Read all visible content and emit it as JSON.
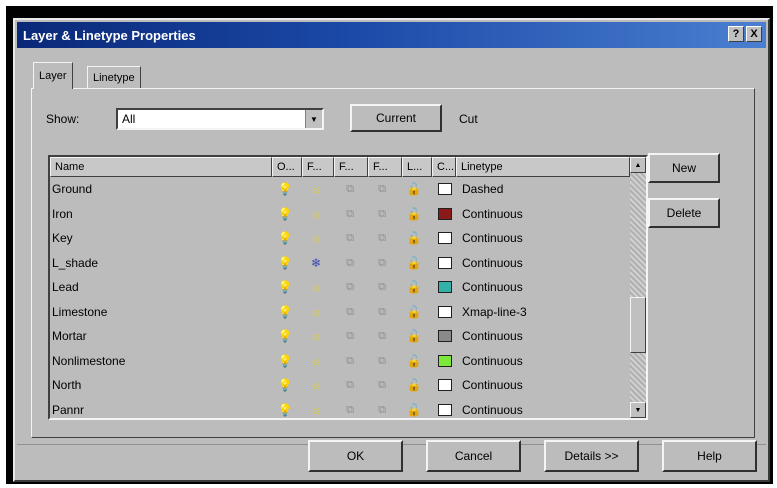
{
  "window": {
    "title": "Layer & Linetype Properties",
    "help_btn": "?",
    "close_btn": "X"
  },
  "tabs": [
    {
      "label": "Layer",
      "active": true
    },
    {
      "label": "Linetype",
      "active": false
    }
  ],
  "show": {
    "label": "Show:",
    "value": "All"
  },
  "current_button": "Current",
  "current_value": "Cut",
  "columns": [
    "Name",
    "O...",
    "F...",
    "F...",
    "F...",
    "L...",
    "C...",
    "Linetype"
  ],
  "layers": [
    {
      "name": "Ground",
      "on": "💡",
      "freeze": "☼",
      "f2": "⧉",
      "f3": "⧉",
      "lock": "🔓",
      "color": "#ffffff",
      "linetype": "Dashed",
      "freeze_state": "thawed"
    },
    {
      "name": "Iron",
      "on": "💡",
      "freeze": "☼",
      "f2": "⧉",
      "f3": "⧉",
      "lock": "🔓",
      "color": "#8a1a1a",
      "linetype": "Continuous",
      "freeze_state": "thawed"
    },
    {
      "name": "Key",
      "on": "💡",
      "freeze": "☼",
      "f2": "⧉",
      "f3": "⧉",
      "lock": "🔓",
      "color": "#ffffff",
      "linetype": "Continuous",
      "freeze_state": "thawed"
    },
    {
      "name": "L_shade",
      "on": "💡",
      "freeze": "❄",
      "f2": "⧉",
      "f3": "⧉",
      "lock": "🔓",
      "color": "#ffffff",
      "linetype": "Continuous",
      "freeze_state": "frozen"
    },
    {
      "name": "Lead",
      "on": "💡",
      "freeze": "☼",
      "f2": "⧉",
      "f3": "⧉",
      "lock": "🔓",
      "color": "#33b0a8",
      "linetype": "Continuous",
      "freeze_state": "thawed"
    },
    {
      "name": "Limestone",
      "on": "💡",
      "freeze": "☼",
      "f2": "⧉",
      "f3": "⧉",
      "lock": "🔓",
      "color": "#ffffff",
      "linetype": "Xmap-line-3",
      "freeze_state": "thawed"
    },
    {
      "name": "Mortar",
      "on": "💡",
      "freeze": "☼",
      "f2": "⧉",
      "f3": "⧉",
      "lock": "🔓",
      "color": "#8a8a8a",
      "linetype": "Continuous",
      "freeze_state": "thawed"
    },
    {
      "name": "Nonlimestone",
      "on": "💡",
      "freeze": "☼",
      "f2": "⧉",
      "f3": "⧉",
      "lock": "🔓",
      "color": "#7ee83a",
      "linetype": "Continuous",
      "freeze_state": "thawed"
    },
    {
      "name": "North",
      "on": "💡",
      "freeze": "☼",
      "f2": "⧉",
      "f3": "⧉",
      "lock": "🔓",
      "color": "#ffffff",
      "linetype": "Continuous",
      "freeze_state": "thawed"
    },
    {
      "name": "Pannr",
      "on": "💡",
      "freeze": "☼",
      "f2": "⧉",
      "f3": "⧉",
      "lock": "🔓",
      "color": "#ffffff",
      "linetype": "Continuous",
      "freeze_state": "thawed"
    }
  ],
  "side_buttons": {
    "new": "New",
    "delete": "Delete"
  },
  "footer_buttons": {
    "ok": "OK",
    "cancel": "Cancel",
    "details": "Details >>",
    "help": "Help"
  },
  "scroll": {
    "up": "▲",
    "down": "▼",
    "thumb_position": 0.6
  },
  "combo_arrow": "▼",
  "colors": {
    "titlebar": "#0a2878",
    "dialog_bg": "#bcbcbc"
  }
}
